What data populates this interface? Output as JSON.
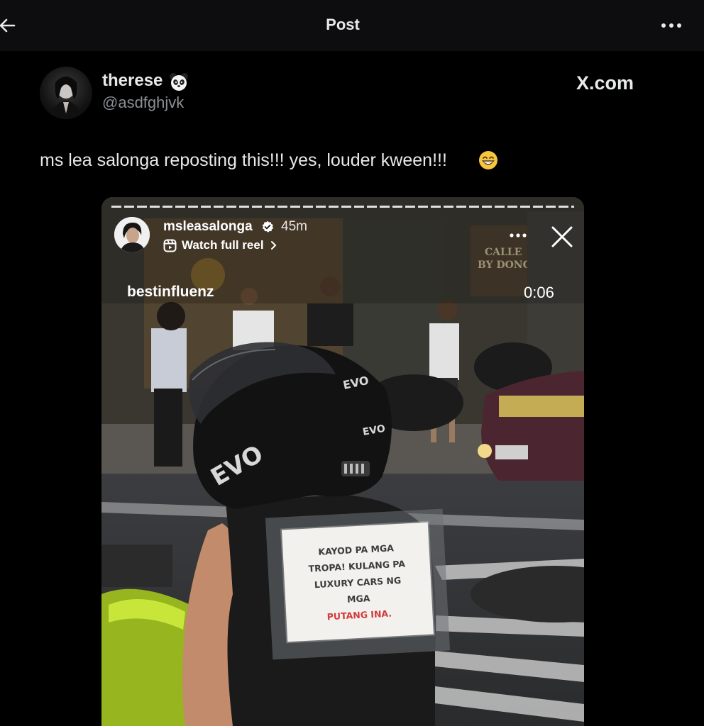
{
  "header": {
    "title": "Post",
    "back_icon": "arrow-left-icon",
    "more_icon": "more-horizontal-icon"
  },
  "author": {
    "display_name": "therese",
    "name_emoji": "panda-face-icon",
    "handle": "@asdfghjvk",
    "source": "X.com"
  },
  "post": {
    "text": "ms lea salonga reposting this!!! yes, louder kween!!!",
    "emoji": "grinning-face-icon"
  },
  "media": {
    "story_username": "msleasalonga",
    "verified": true,
    "story_time": "45m",
    "watch_label": "Watch full reel",
    "overlay_username": "bestinfluenz",
    "timecode": "0:06",
    "sign_lines": [
      "KAYOD PA MGA",
      "TROPA! KULANG PA",
      "LUXURY CARS NG",
      "MGA",
      "PUTANG INA."
    ],
    "sign_highlight_color": "#d23a3a",
    "helmet_brand": "EVO",
    "storefront_sign": "CALLE BY DONG"
  }
}
